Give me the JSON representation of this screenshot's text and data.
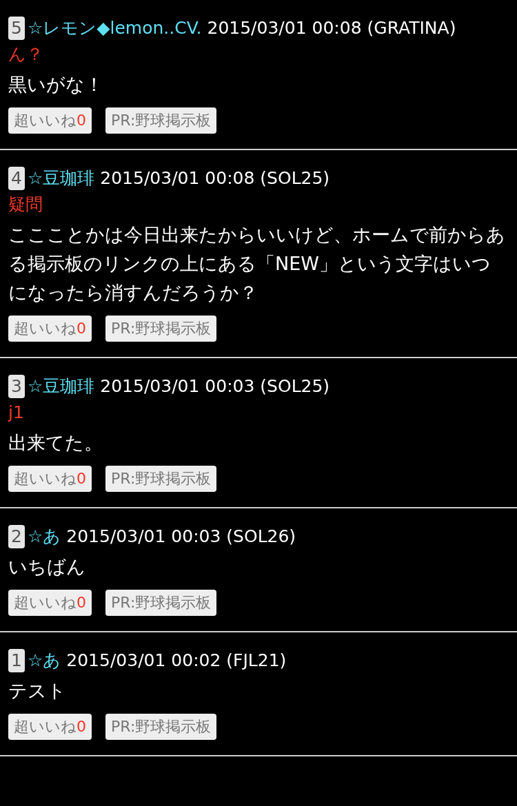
{
  "posts": [
    {
      "number": "5",
      "author": "☆レモン◆lemon..CV.",
      "date": "2015/03/01 00:08",
      "device": "(GRATINA)",
      "subject": "ん？",
      "body": "黒いがな！",
      "like_label": "超いいね",
      "like_count": "0",
      "pr_link": "PR:野球掲示板"
    },
    {
      "number": "4",
      "author": "☆豆珈琲",
      "date": "2015/03/01 00:08",
      "device": "(SOL25)",
      "subject": "疑問",
      "body": "ここことかは今日出来たからいいけど、ホームで前からある掲示板のリンクの上にある「NEW」という文字はいつになったら消すんだろうか？",
      "like_label": "超いいね",
      "like_count": "0",
      "pr_link": "PR:野球掲示板"
    },
    {
      "number": "3",
      "author": "☆豆珈琲",
      "date": "2015/03/01 00:03",
      "device": "(SOL25)",
      "subject": "j1",
      "body": "出来てた。",
      "like_label": "超いいね",
      "like_count": "0",
      "pr_link": "PR:野球掲示板"
    },
    {
      "number": "2",
      "author": "☆あ",
      "date": "2015/03/01 00:03",
      "device": "(SOL26)",
      "body": "いちばん",
      "like_label": "超いいね",
      "like_count": "0",
      "pr_link": "PR:野球掲示板"
    },
    {
      "number": "1",
      "author": "☆あ",
      "date": "2015/03/01 00:02",
      "device": "(FJL21)",
      "body": "テスト",
      "like_label": "超いいね",
      "like_count": "0",
      "pr_link": "PR:野球掲示板"
    }
  ]
}
